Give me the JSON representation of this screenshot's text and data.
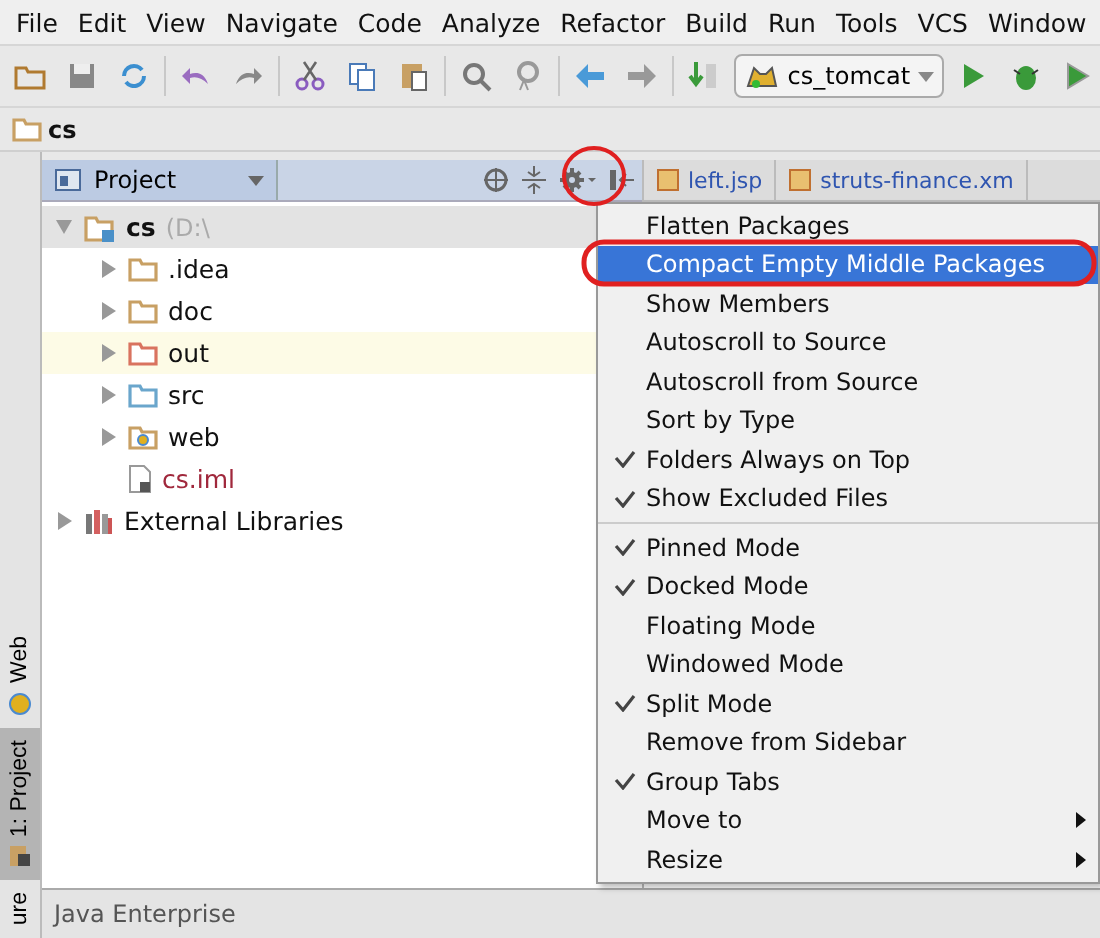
{
  "menu_bar": [
    "File",
    "Edit",
    "View",
    "Navigate",
    "Code",
    "Analyze",
    "Refactor",
    "Build",
    "Run",
    "Tools",
    "VCS",
    "Window"
  ],
  "toolbar": {
    "run_config": "cs_tomcat"
  },
  "breadcrumb": "cs",
  "side_tabs": [
    {
      "label": "Web",
      "selected": false
    },
    {
      "label": "1: Project",
      "selected": true
    },
    {
      "label": "ure",
      "selected": false
    }
  ],
  "project_panel": {
    "title": "Project"
  },
  "editor_tabs": [
    "left.jsp",
    "struts-finance.xm"
  ],
  "tree": [
    {
      "label": "cs",
      "note": "(D:\\",
      "kind": "module",
      "expanded": true,
      "highlighted": false,
      "children": [
        {
          "label": ".idea",
          "kind": "folder",
          "color": "#c8a064",
          "expanded": false,
          "highlighted": false
        },
        {
          "label": "doc",
          "kind": "folder",
          "color": "#c8a064",
          "expanded": false,
          "highlighted": false
        },
        {
          "label": "out",
          "kind": "folder",
          "color": "#d9735f",
          "expanded": false,
          "highlighted": true
        },
        {
          "label": "src",
          "kind": "folder",
          "color": "#6aa6cc",
          "expanded": false,
          "highlighted": false
        },
        {
          "label": "web",
          "kind": "webfolder",
          "color": "#c8a064",
          "expanded": false,
          "highlighted": false
        },
        {
          "label": "cs.iml",
          "kind": "file",
          "highlighted": false
        }
      ]
    },
    {
      "label": "External Libraries",
      "kind": "library",
      "expanded": false,
      "highlighted": false
    }
  ],
  "popup_menu": [
    {
      "kind": "item",
      "label": "Flatten Packages",
      "checked": false,
      "selected": false
    },
    {
      "kind": "item",
      "label": "Compact Empty Middle Packages",
      "checked": false,
      "selected": true
    },
    {
      "kind": "item",
      "label": "Show Members",
      "checked": false,
      "selected": false
    },
    {
      "kind": "item",
      "label": "Autoscroll to Source",
      "checked": false,
      "selected": false
    },
    {
      "kind": "item",
      "label": "Autoscroll from Source",
      "checked": false,
      "selected": false
    },
    {
      "kind": "item",
      "label": "Sort by Type",
      "checked": false,
      "selected": false
    },
    {
      "kind": "item",
      "label": "Folders Always on Top",
      "checked": true,
      "selected": false
    },
    {
      "kind": "item",
      "label": "Show Excluded Files",
      "checked": true,
      "selected": false
    },
    {
      "kind": "separator"
    },
    {
      "kind": "item",
      "label": "Pinned Mode",
      "checked": true,
      "selected": false
    },
    {
      "kind": "item",
      "label": "Docked Mode",
      "checked": true,
      "selected": false
    },
    {
      "kind": "item",
      "label": "Floating Mode",
      "checked": false,
      "selected": false
    },
    {
      "kind": "item",
      "label": "Windowed Mode",
      "checked": false,
      "selected": false
    },
    {
      "kind": "item",
      "label": "Split Mode",
      "checked": true,
      "selected": false
    },
    {
      "kind": "item",
      "label": "Remove from Sidebar",
      "checked": false,
      "selected": false
    },
    {
      "kind": "item",
      "label": "Group Tabs",
      "checked": true,
      "selected": false
    },
    {
      "kind": "submenu",
      "label": "Move to",
      "checked": false,
      "selected": false
    },
    {
      "kind": "submenu",
      "label": "Resize",
      "checked": false,
      "selected": false
    }
  ],
  "status_bar": "Java Enterprise"
}
